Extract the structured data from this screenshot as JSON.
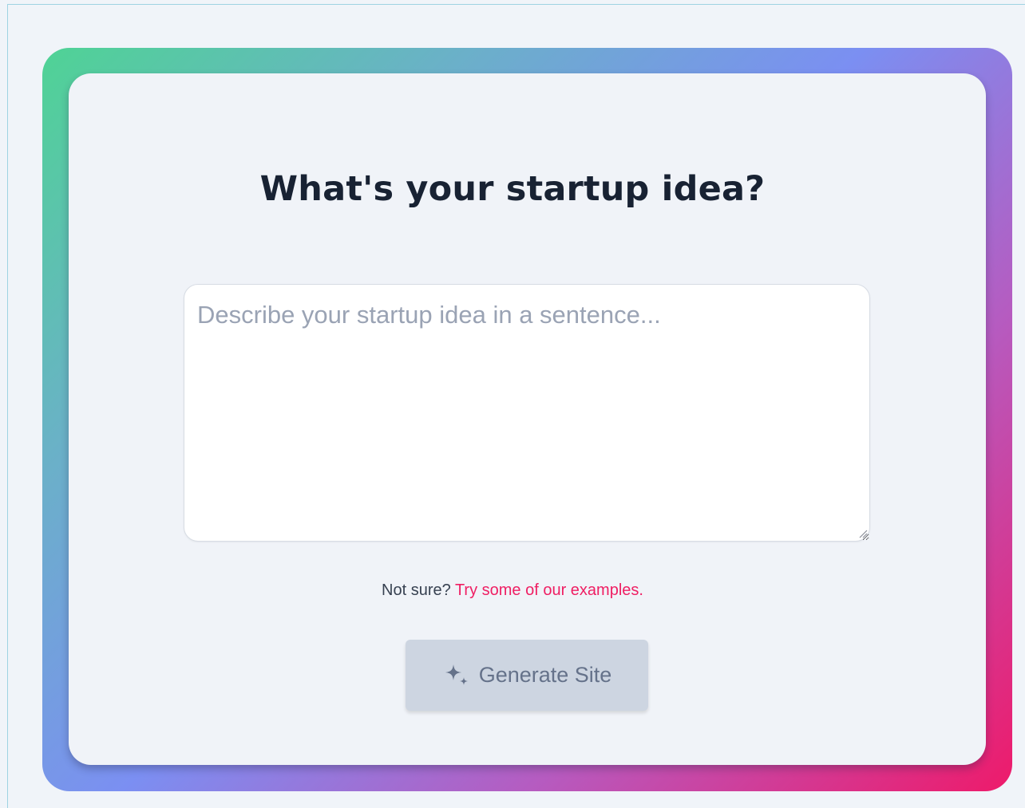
{
  "colors": {
    "page_background": "#f0f4f9",
    "card_background": "#f0f3f8",
    "gradient_start": "#4fd395",
    "gradient_mid": "#7b8ff2",
    "gradient_end": "#ee1a6a",
    "title": "#182233",
    "link": "#ef1e63",
    "button_background": "#cdd5e1",
    "button_text": "#65728a"
  },
  "card": {
    "title": "What's your startup idea?"
  },
  "idea_input": {
    "value": "",
    "placeholder": "Describe your startup idea in a sentence..."
  },
  "hint": {
    "prefix": "Not sure? ",
    "link_label": "Try some of our examples",
    "suffix": "."
  },
  "generate_button": {
    "icon": "sparkles-icon",
    "label": "Generate Site"
  }
}
